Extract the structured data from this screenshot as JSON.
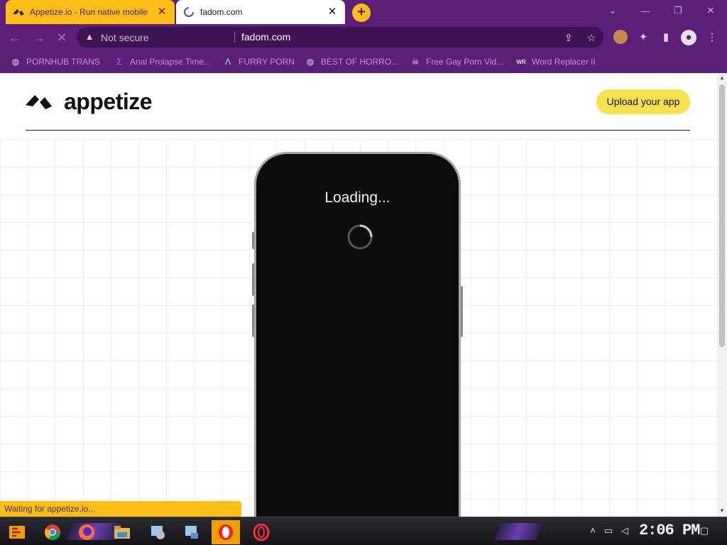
{
  "browser": {
    "tabs": [
      {
        "title": "Appetize.io - Run native mobile",
        "close": "✕",
        "active": false
      },
      {
        "title": "fadom.com",
        "close": "✕",
        "active": true
      }
    ],
    "new_tab": "+",
    "window_controls": {
      "minimize": "—",
      "restore": "❐",
      "close": "✕",
      "dropdown": "⌄"
    },
    "nav": {
      "back": "←",
      "forward": "→",
      "stop": "✕"
    },
    "address": {
      "security": "Not secure",
      "url": "fadom.com"
    },
    "toolbar_icons": {
      "share": "⇪",
      "star": "☆",
      "extensions": "✦",
      "sidebar": "▮",
      "menu": "⋮"
    },
    "bookmarks": [
      {
        "label": "PORNHUB TRANS",
        "icon": "globe-icon"
      },
      {
        "label": "Anal Prolapse Time...",
        "icon": "sigma-icon"
      },
      {
        "label": "FURRY PORN",
        "icon": "lambda-icon"
      },
      {
        "label": "BEST OF HORRO...",
        "icon": "globe-icon"
      },
      {
        "label": "Free Gay Porn Vid...",
        "icon": "skull-icon"
      },
      {
        "label": "Word Replacer II",
        "icon": "wr-icon"
      }
    ],
    "status": "Waiting for appetize.io..."
  },
  "page": {
    "logo_text": "appetize",
    "upload_button": "Upload your app",
    "device": {
      "loading_text": "Loading..."
    }
  },
  "taskbar": {
    "clock": "2:06 PM",
    "tray_icons": [
      "chevron-up-icon",
      "network-icon",
      "volume-icon",
      "notification-icon"
    ]
  },
  "colors": {
    "browser_purple": "#5b1f78",
    "tab_yellow": "#fbbd16",
    "cta_yellow": "#f7e24d"
  }
}
